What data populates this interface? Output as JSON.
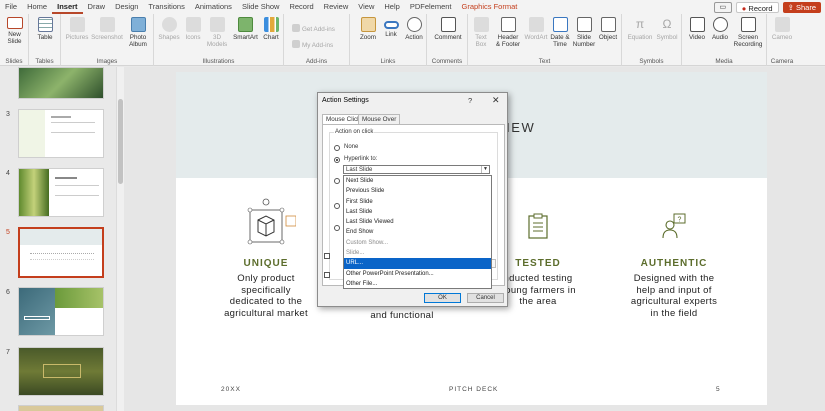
{
  "ribbon_tabs": [
    "File",
    "Home",
    "Insert",
    "Draw",
    "Design",
    "Transitions",
    "Animations",
    "Slide Show",
    "Record",
    "Review",
    "View",
    "Help",
    "PDFelement",
    "Graphics Format"
  ],
  "header_right": {
    "record": "Record",
    "share": "Share"
  },
  "ribbon": {
    "slides": {
      "label": "Slides",
      "new_slide": [
        "New",
        "Slide"
      ]
    },
    "tables": {
      "label": "Tables",
      "table": "Table"
    },
    "images": {
      "label": "Images",
      "pictures": "Pictures",
      "screenshot": "Screenshot",
      "photo_album": [
        "Photo",
        "Album"
      ]
    },
    "illustrations": {
      "label": "Illustrations",
      "shapes": "Shapes",
      "icons": "Icons",
      "models": [
        "3D",
        "Models"
      ],
      "smartart": "SmartArt",
      "chart": "Chart"
    },
    "addins": {
      "label": "Add-ins",
      "get": "Get Add-ins",
      "my": "My Add-ins"
    },
    "links": {
      "label": "Links",
      "zoom": "Zoom",
      "link": "Link",
      "action": "Action"
    },
    "comments": {
      "label": "Comments",
      "comment": "Comment"
    },
    "text": {
      "label": "Text",
      "textbox": [
        "Text",
        "Box"
      ],
      "header_footer": [
        "Header",
        "& Footer"
      ],
      "wordart": "WordArt",
      "date_time": [
        "Date &",
        "Time"
      ],
      "slide_number": [
        "Slide",
        "Number"
      ],
      "object": "Object"
    },
    "symbols": {
      "label": "Symbols",
      "equation": "Equation",
      "symbol": "Symbol"
    },
    "media": {
      "label": "Media",
      "video": "Video",
      "audio": "Audio",
      "screen_recording": [
        "Screen",
        "Recording"
      ]
    },
    "camera": {
      "label": "Camera",
      "cameo": "Cameo"
    }
  },
  "thumbnails": [
    {
      "number": "3"
    },
    {
      "number": "4"
    },
    {
      "number": "5",
      "selected": true
    },
    {
      "number": "6"
    },
    {
      "number": "7"
    }
  ],
  "slide": {
    "title_fragment": "VIEW",
    "features": [
      {
        "title": "UNIQUE",
        "text": [
          "Only product",
          "specifically",
          "dedicated to the",
          "agricultural market"
        ]
      },
      {
        "title": "",
        "text": [
          "and functional"
        ]
      },
      {
        "title": "TESTED",
        "text": [
          "nducted testing",
          "young farmers in",
          "the area"
        ]
      },
      {
        "title": "AUTHENTIC",
        "text": [
          "Designed with the",
          "help and input of",
          "agricultural experts",
          "in the field"
        ]
      }
    ],
    "footer_left": "20XX",
    "footer_center": "PITCH DECK",
    "footer_right": "5"
  },
  "dialog": {
    "title": "Action Settings",
    "help": "?",
    "close": "✕",
    "tabs": [
      "Mouse Click",
      "Mouse Over"
    ],
    "group_label": "Action on click",
    "none": "None",
    "hyperlink_to": "Hyperlink to:",
    "hyperlink_value": "Last Slide",
    "options": [
      {
        "label": "Next Slide"
      },
      {
        "label": "Previous Slide"
      },
      {
        "label": "First Slide"
      },
      {
        "label": "Last Slide"
      },
      {
        "label": "Last Slide Viewed"
      },
      {
        "label": "End Show"
      },
      {
        "label": "Custom Show...",
        "disabled": true
      },
      {
        "label": "Slide...",
        "disabled": true
      },
      {
        "label": "URL...",
        "highlighted": true
      },
      {
        "label": "Other PowerPoint Presentation..."
      },
      {
        "label": "Other File..."
      }
    ],
    "ok": "OK",
    "cancel": "Cancel"
  },
  "colors": {
    "accent": "#c43e1c",
    "olive": "#5c6d2c",
    "header_band": "#e4ebec",
    "highlight": "#0a64c8"
  }
}
